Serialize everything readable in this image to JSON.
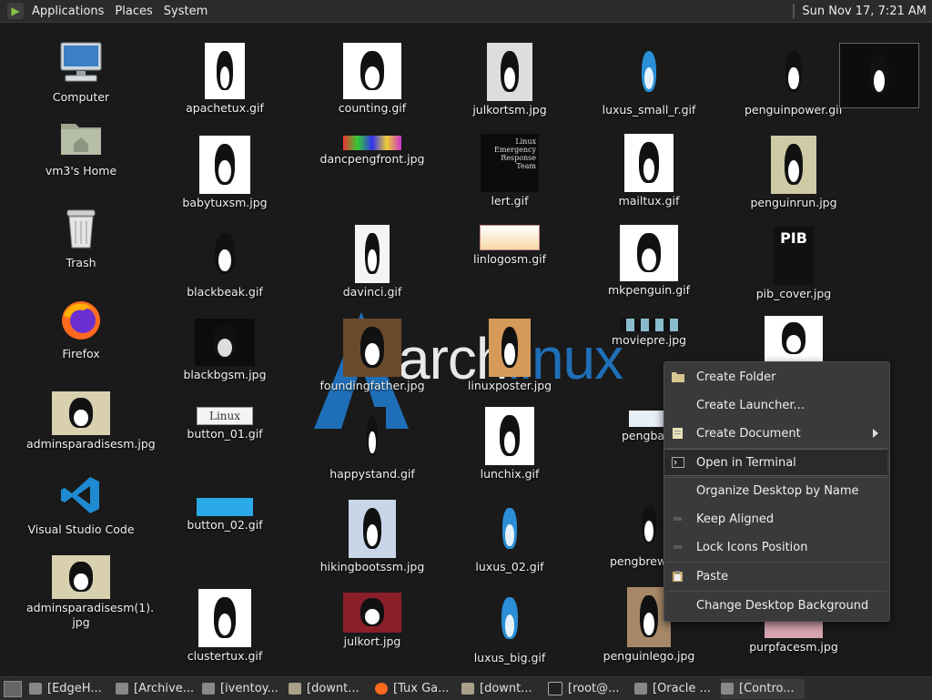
{
  "top_panel": {
    "menus": [
      "Applications",
      "Places",
      "System"
    ],
    "clock": "Sun Nov 17,  7:21 AM"
  },
  "wallpaper": {
    "word_left": "arch",
    "word_right": "inux",
    "word_mid": "l"
  },
  "desktop": {
    "system_icons": [
      {
        "label": "Computer"
      },
      {
        "label": "vm3's Home"
      },
      {
        "label": "Trash"
      },
      {
        "label": "Firefox"
      },
      {
        "label": "adminsparadisesm.jpg"
      },
      {
        "label": "Visual Studio Code"
      },
      {
        "label": "adminsparadisesm(1).\njpg"
      }
    ],
    "files": [
      "apachetux.gif",
      "counting.gif",
      "julkortsm.jpg",
      "luxus_small_r.gif",
      "penguinpower.gif",
      "babytuxsm.jpg",
      "dancpengfront.jpg",
      "lert.gif",
      "mailtux.gif",
      "penguinrun.jpg",
      "blackbeak.gif",
      "davinci.gif",
      "linlogosm.gif",
      "mkpenguin.gif",
      "pib_cover.jpg",
      "blackbgsm.jpg",
      "foundingfather.jpg",
      "linuxposter.jpg",
      "moviepre.jpg",
      "button_01.gif",
      "happystand.gif",
      "lunchix.gif",
      "pengba",
      "button_02.gif",
      "hikingbootssm.jpg",
      "luxus_02.gif",
      "pengbrew",
      "clustertux.gif",
      "julkort.jpg",
      "luxus_big.gif",
      "penguinlego.jpg",
      "purpfacesm.jpg"
    ],
    "thumb_texts": {
      "linux_button": "Linux",
      "pib": "PIB",
      "lert": "Linux Emergency Response Team"
    }
  },
  "context_menu": {
    "items": [
      {
        "label": "Create Folder"
      },
      {
        "label": "Create Launcher..."
      },
      {
        "label": "Create Document"
      },
      {
        "label": "Open in Terminal"
      },
      {
        "label": "Organize Desktop by Name"
      },
      {
        "label": "Keep Aligned"
      },
      {
        "label": "Lock Icons Position"
      },
      {
        "label": "Paste"
      },
      {
        "label": "Change Desktop Background"
      }
    ]
  },
  "taskbar": {
    "tasks": [
      "[EdgeH...",
      "[Archive...",
      "[iventoy...",
      "[downt...",
      "[Tux Ga...",
      "[downt...",
      "[root@...",
      "[Oracle ...",
      "[Contro..."
    ]
  },
  "colors": {
    "accent": "#1f6fb8",
    "panel": "#2b2b2b",
    "menu_bg": "#3a3a3a"
  }
}
